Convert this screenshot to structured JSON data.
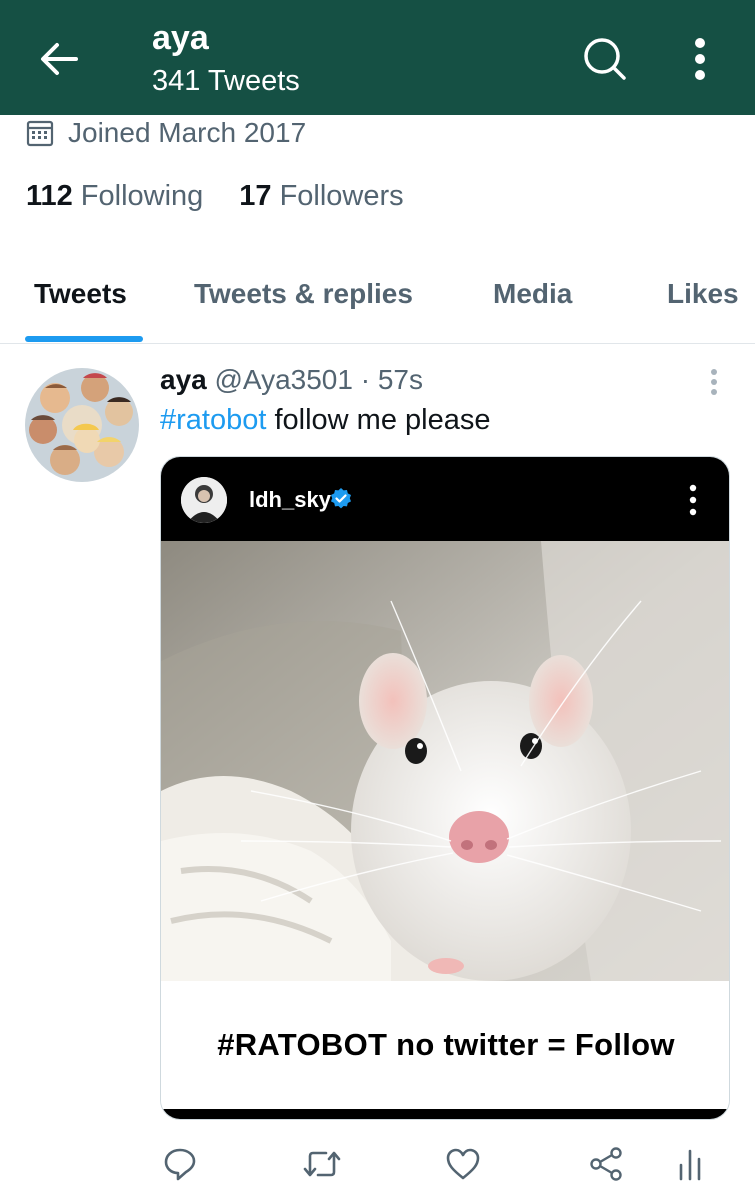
{
  "header": {
    "title": "aya",
    "tweet_count": "341 Tweets",
    "background_color": "#155044"
  },
  "profile": {
    "joined": "Joined March 2017",
    "following_count": "112",
    "following_label": "Following",
    "followers_count": "17",
    "followers_label": "Followers"
  },
  "tabs": [
    {
      "label": "Tweets",
      "active": true
    },
    {
      "label": "Tweets & replies",
      "active": false
    },
    {
      "label": "Media",
      "active": false
    },
    {
      "label": "Likes",
      "active": false
    }
  ],
  "tweet": {
    "name": "aya",
    "handle": "@Aya3501",
    "separator": "·",
    "time": "57s",
    "hashtag": "#ratobot",
    "text": " follow me please",
    "media": {
      "account_name": "ldh_sky",
      "caption": "#RATOBOT no twitter = Follow"
    }
  },
  "icons": {
    "back": "arrow-left-icon",
    "search": "search-icon",
    "more": "more-vertical-icon",
    "calendar": "calendar-icon",
    "verified": "verified-badge-icon",
    "reply": "reply-icon",
    "retweet": "retweet-icon",
    "like": "heart-icon",
    "share": "share-icon",
    "analytics": "analytics-icon"
  },
  "colors": {
    "accent": "#1d9bf0",
    "text": "#0f1419",
    "muted": "#536471"
  }
}
